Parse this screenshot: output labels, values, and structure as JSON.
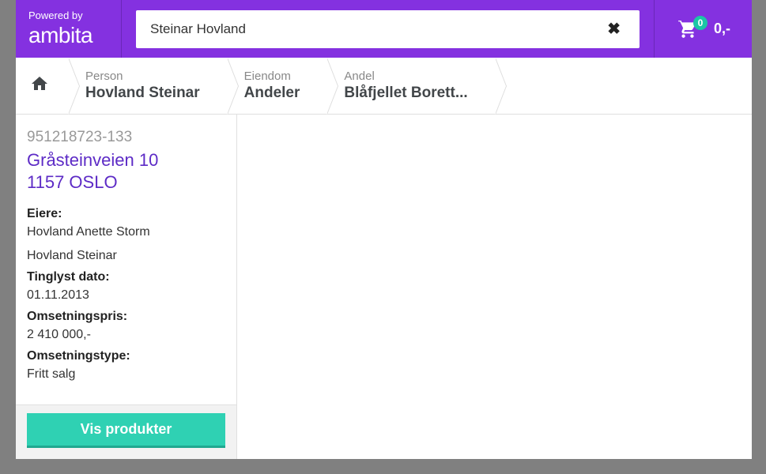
{
  "brand": {
    "powered_by": "Powered by",
    "name": "ambita"
  },
  "search": {
    "value": "Steinar Hovland",
    "clear_glyph": "✖"
  },
  "cart": {
    "count": "0",
    "total": "0,-"
  },
  "breadcrumb": [
    {
      "label": "Person",
      "value": "Hovland Steinar"
    },
    {
      "label": "Eiendom",
      "value": "Andeler"
    },
    {
      "label": "Andel",
      "value": "Blåfjellet Borett..."
    }
  ],
  "detail": {
    "id": "951218723-133",
    "address_line1": "Gråsteinveien 10",
    "address_line2": "1157 OSLO",
    "owners_label": "Eiere:",
    "owners": [
      "Hovland Anette Storm",
      "Hovland Steinar"
    ],
    "tinglyst_label": "Tinglyst dato:",
    "tinglyst_value": "01.11.2013",
    "price_label": "Omsetningspris:",
    "price_value": "2 410 000,-",
    "type_label": "Omsetningstype:",
    "type_value": "Fritt salg",
    "button": "Vis produkter"
  }
}
